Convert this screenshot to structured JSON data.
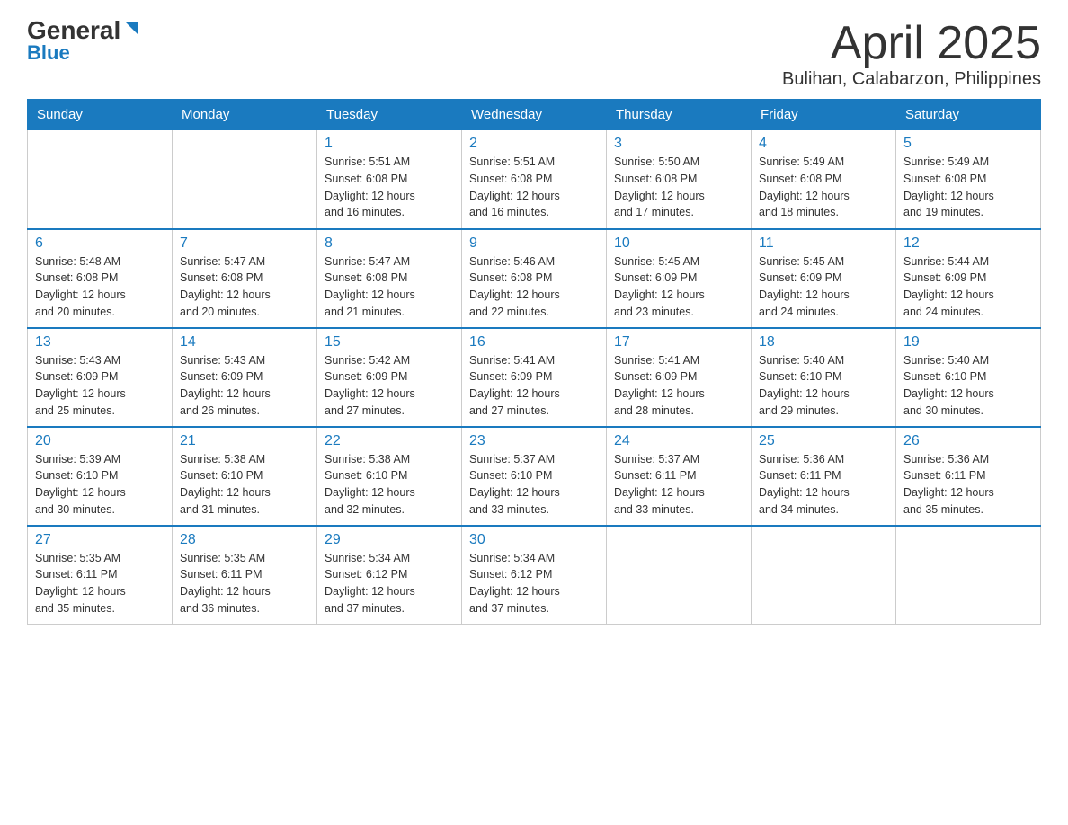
{
  "logo": {
    "line1": "General",
    "line2": "Blue"
  },
  "title": "April 2025",
  "subtitle": "Bulihan, Calabarzon, Philippines",
  "weekdays": [
    "Sunday",
    "Monday",
    "Tuesday",
    "Wednesday",
    "Thursday",
    "Friday",
    "Saturday"
  ],
  "weeks": [
    [
      {
        "day": "",
        "info": ""
      },
      {
        "day": "",
        "info": ""
      },
      {
        "day": "1",
        "info": "Sunrise: 5:51 AM\nSunset: 6:08 PM\nDaylight: 12 hours\nand 16 minutes."
      },
      {
        "day": "2",
        "info": "Sunrise: 5:51 AM\nSunset: 6:08 PM\nDaylight: 12 hours\nand 16 minutes."
      },
      {
        "day": "3",
        "info": "Sunrise: 5:50 AM\nSunset: 6:08 PM\nDaylight: 12 hours\nand 17 minutes."
      },
      {
        "day": "4",
        "info": "Sunrise: 5:49 AM\nSunset: 6:08 PM\nDaylight: 12 hours\nand 18 minutes."
      },
      {
        "day": "5",
        "info": "Sunrise: 5:49 AM\nSunset: 6:08 PM\nDaylight: 12 hours\nand 19 minutes."
      }
    ],
    [
      {
        "day": "6",
        "info": "Sunrise: 5:48 AM\nSunset: 6:08 PM\nDaylight: 12 hours\nand 20 minutes."
      },
      {
        "day": "7",
        "info": "Sunrise: 5:47 AM\nSunset: 6:08 PM\nDaylight: 12 hours\nand 20 minutes."
      },
      {
        "day": "8",
        "info": "Sunrise: 5:47 AM\nSunset: 6:08 PM\nDaylight: 12 hours\nand 21 minutes."
      },
      {
        "day": "9",
        "info": "Sunrise: 5:46 AM\nSunset: 6:08 PM\nDaylight: 12 hours\nand 22 minutes."
      },
      {
        "day": "10",
        "info": "Sunrise: 5:45 AM\nSunset: 6:09 PM\nDaylight: 12 hours\nand 23 minutes."
      },
      {
        "day": "11",
        "info": "Sunrise: 5:45 AM\nSunset: 6:09 PM\nDaylight: 12 hours\nand 24 minutes."
      },
      {
        "day": "12",
        "info": "Sunrise: 5:44 AM\nSunset: 6:09 PM\nDaylight: 12 hours\nand 24 minutes."
      }
    ],
    [
      {
        "day": "13",
        "info": "Sunrise: 5:43 AM\nSunset: 6:09 PM\nDaylight: 12 hours\nand 25 minutes."
      },
      {
        "day": "14",
        "info": "Sunrise: 5:43 AM\nSunset: 6:09 PM\nDaylight: 12 hours\nand 26 minutes."
      },
      {
        "day": "15",
        "info": "Sunrise: 5:42 AM\nSunset: 6:09 PM\nDaylight: 12 hours\nand 27 minutes."
      },
      {
        "day": "16",
        "info": "Sunrise: 5:41 AM\nSunset: 6:09 PM\nDaylight: 12 hours\nand 27 minutes."
      },
      {
        "day": "17",
        "info": "Sunrise: 5:41 AM\nSunset: 6:09 PM\nDaylight: 12 hours\nand 28 minutes."
      },
      {
        "day": "18",
        "info": "Sunrise: 5:40 AM\nSunset: 6:10 PM\nDaylight: 12 hours\nand 29 minutes."
      },
      {
        "day": "19",
        "info": "Sunrise: 5:40 AM\nSunset: 6:10 PM\nDaylight: 12 hours\nand 30 minutes."
      }
    ],
    [
      {
        "day": "20",
        "info": "Sunrise: 5:39 AM\nSunset: 6:10 PM\nDaylight: 12 hours\nand 30 minutes."
      },
      {
        "day": "21",
        "info": "Sunrise: 5:38 AM\nSunset: 6:10 PM\nDaylight: 12 hours\nand 31 minutes."
      },
      {
        "day": "22",
        "info": "Sunrise: 5:38 AM\nSunset: 6:10 PM\nDaylight: 12 hours\nand 32 minutes."
      },
      {
        "day": "23",
        "info": "Sunrise: 5:37 AM\nSunset: 6:10 PM\nDaylight: 12 hours\nand 33 minutes."
      },
      {
        "day": "24",
        "info": "Sunrise: 5:37 AM\nSunset: 6:11 PM\nDaylight: 12 hours\nand 33 minutes."
      },
      {
        "day": "25",
        "info": "Sunrise: 5:36 AM\nSunset: 6:11 PM\nDaylight: 12 hours\nand 34 minutes."
      },
      {
        "day": "26",
        "info": "Sunrise: 5:36 AM\nSunset: 6:11 PM\nDaylight: 12 hours\nand 35 minutes."
      }
    ],
    [
      {
        "day": "27",
        "info": "Sunrise: 5:35 AM\nSunset: 6:11 PM\nDaylight: 12 hours\nand 35 minutes."
      },
      {
        "day": "28",
        "info": "Sunrise: 5:35 AM\nSunset: 6:11 PM\nDaylight: 12 hours\nand 36 minutes."
      },
      {
        "day": "29",
        "info": "Sunrise: 5:34 AM\nSunset: 6:12 PM\nDaylight: 12 hours\nand 37 minutes."
      },
      {
        "day": "30",
        "info": "Sunrise: 5:34 AM\nSunset: 6:12 PM\nDaylight: 12 hours\nand 37 minutes."
      },
      {
        "day": "",
        "info": ""
      },
      {
        "day": "",
        "info": ""
      },
      {
        "day": "",
        "info": ""
      }
    ]
  ]
}
